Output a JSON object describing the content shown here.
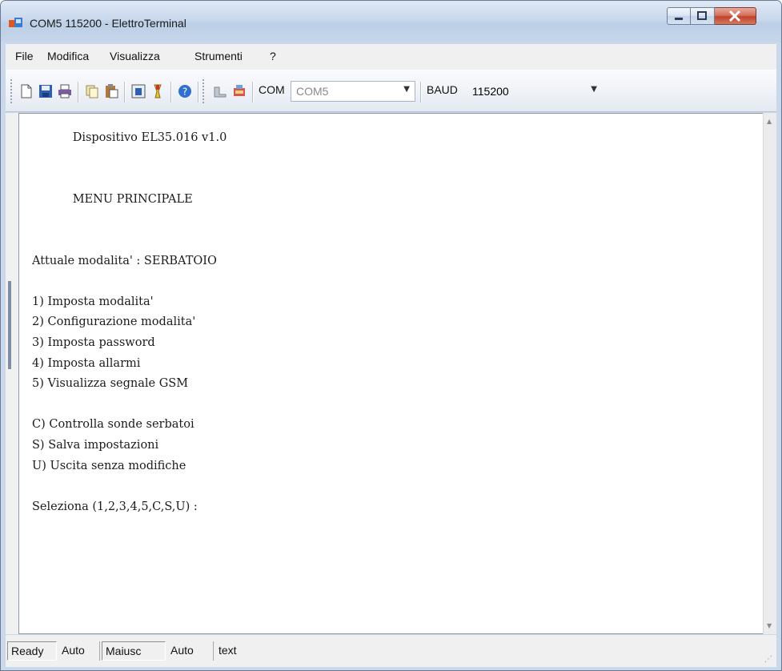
{
  "window": {
    "title": "COM5 115200 - ElettroTerminal"
  },
  "menu": [
    {
      "label": "File"
    },
    {
      "label": "Modifica"
    },
    {
      "label": "Visualizza"
    },
    {
      "label": "Strumenti"
    },
    {
      "label": "?"
    }
  ],
  "toolbar": {
    "icons": [
      "new-file-icon",
      "save-icon",
      "print-icon",
      "copy-icon",
      "paste-icon",
      "capture-icon",
      "clear-icon",
      "help-icon",
      "connect-icon",
      "disconnect-icon"
    ],
    "com_label": "COM",
    "com_value": "COM5",
    "baud_label": "BAUD",
    "baud_value": "115200"
  },
  "terminal": {
    "lines": [
      "           Dispositivo EL35.016 v1.0",
      "",
      "",
      "           MENU PRINCIPALE",
      "",
      "",
      "Attuale modalita' : SERBATOIO",
      "",
      "1) Imposta modalita'",
      "2) Configurazione modalita'",
      "3) Imposta password",
      "4) Imposta allarmi",
      "5) Visualizza segnale GSM",
      "",
      "C) Controlla sonde serbatoi",
      "S) Salva impostazioni",
      "U) Uscita senza modifiche",
      "",
      "Seleziona (1,2,3,4,5,C,S,U) :"
    ]
  },
  "statusbar": {
    "panels": [
      "Ready",
      "Auto",
      "Maiusc",
      "Auto",
      "text"
    ]
  },
  "colors": {
    "title_gradient": "#c8d8ec",
    "close_button": "#c2432c",
    "terminal_bg": "#ffffff"
  }
}
